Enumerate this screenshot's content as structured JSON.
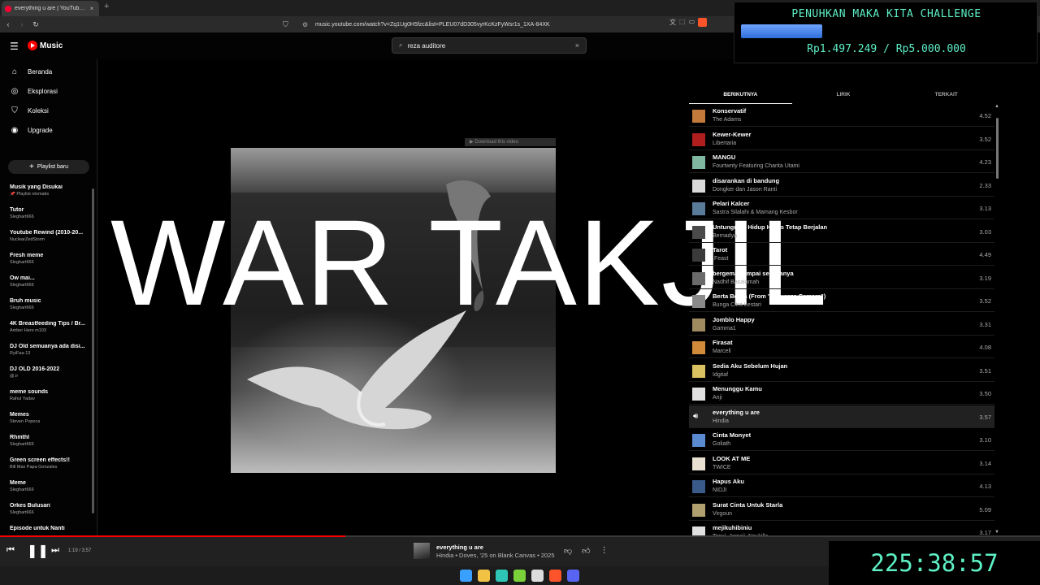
{
  "browser": {
    "tab_title": "everything u are | YouTube Music",
    "tab_close": "×",
    "new_tab": "+",
    "url": "music.youtube.com/watch?v=Zq1Ug0H5fzc&list=PLEU07dD305vyrKcKzFyWsr1s_1XA-84XK"
  },
  "header": {
    "logo": "Music",
    "search_value": "reza auditore",
    "search_clear": "×"
  },
  "sidebar": {
    "nav": [
      {
        "label": "Beranda",
        "icon": "home-icon"
      },
      {
        "label": "Eksplorasi",
        "icon": "compass-icon"
      },
      {
        "label": "Koleksi",
        "icon": "bookmark-icon"
      },
      {
        "label": "Upgrade",
        "icon": "youtube-icon"
      }
    ],
    "new_playlist": "Playlist baru",
    "playlists": [
      {
        "name": "Musik yang Disukai",
        "sub": "📌 Playlist otomatis"
      },
      {
        "name": "Tutor",
        "sub": "Sleghart666"
      },
      {
        "name": "Youtube Rewind (2010-20...",
        "sub": "NuclearZedStorm"
      },
      {
        "name": "Fresh meme",
        "sub": "Sleghart666"
      },
      {
        "name": "Ow mai...",
        "sub": "Sleghart666"
      },
      {
        "name": "Bruh music",
        "sub": "Sleghart666"
      },
      {
        "name": "4K Breastfeeding Tips / Br...",
        "sub": "Amber Hero m103"
      },
      {
        "name": "DJ Old semuanya ada disi...",
        "sub": "RyiFaa-13"
      },
      {
        "name": "DJ OLD 2016-2022",
        "sub": "@.ir"
      },
      {
        "name": "meme sounds",
        "sub": "Rahul Yadav"
      },
      {
        "name": "Memes",
        "sub": "Steven Popoca"
      },
      {
        "name": "Rhmthl",
        "sub": "Sleghart666"
      },
      {
        "name": "Green screen effects!!",
        "sub": "Bill Max Papa Gonzales"
      },
      {
        "name": "Meme",
        "sub": "Sleghart666"
      },
      {
        "name": "Orkes Bulusari",
        "sub": "Sleghart666"
      },
      {
        "name": "Episode untuk Nanti",
        "sub": ""
      }
    ]
  },
  "main": {
    "download_bar": "▶ Download this video",
    "overlay_text": "WAR TAKJIL"
  },
  "queue": {
    "tabs": [
      "BERIKUTNYA",
      "LIRIK",
      "TERKAIT"
    ],
    "items": [
      {
        "title": "Konservatif",
        "artist": "The Adams",
        "duration": "4.52",
        "color": "#c47a3b"
      },
      {
        "title": "Kewer-Kewer",
        "artist": "Libertaria",
        "duration": "3.52",
        "color": "#b01e1e"
      },
      {
        "title": "MANGU",
        "artist": "Fourtwnty Featuring Charita Utami",
        "duration": "4.23",
        "color": "#7fb7a0"
      },
      {
        "title": "disarankan di bandung",
        "artist": "Dongker dan Jason Ranti",
        "duration": "2.33",
        "color": "#d9d9d9"
      },
      {
        "title": "Pelari Kalcer",
        "artist": "Sastra Silalahi & Mamang Kesbor",
        "duration": "3.13",
        "color": "#5a7a9a"
      },
      {
        "title": "Untungnya, Hidup Harus Tetap Berjalan",
        "artist": "Bernadya",
        "duration": "3.03",
        "color": "#4a4a4a"
      },
      {
        "title": "Tarot",
        "artist": ".Feast",
        "duration": "4.49",
        "color": "#3a3a3a"
      },
      {
        "title": "bergema sampai selamanya",
        "artist": "Nadhif Basalamah",
        "duration": "3.19",
        "color": "#6a6a6a"
      },
      {
        "title": "Berta Berita (From \"Keluarga Cemara\")",
        "artist": "Bunga Citra Lestari",
        "duration": "3.52",
        "color": "#8a8a8a"
      },
      {
        "title": "Jomblo Happy",
        "artist": "Gamma1",
        "duration": "3.31",
        "color": "#a08a60"
      },
      {
        "title": "Firasat",
        "artist": "Marcell",
        "duration": "4.08",
        "color": "#d08a3a"
      },
      {
        "title": "Sedia Aku Sebelum Hujan",
        "artist": "Idgitaf",
        "duration": "3.51",
        "color": "#d9c060"
      },
      {
        "title": "Menunggu Kamu",
        "artist": "Anji",
        "duration": "3.50",
        "color": "#e0e0e0"
      },
      {
        "title": "everything u are",
        "artist": "Hindia",
        "duration": "3.57",
        "color": "#212121",
        "playing": true
      },
      {
        "title": "Cinta Monyet",
        "artist": "Goliath",
        "duration": "3.10",
        "color": "#5a8ad0"
      },
      {
        "title": "LOOK AT ME",
        "artist": "TWICE",
        "duration": "3.14",
        "color": "#e8e0d0"
      },
      {
        "title": "Hapus Aku",
        "artist": "NIDJI",
        "duration": "4.13",
        "color": "#3a5a8a"
      },
      {
        "title": "Surat Cinta Untuk Starla",
        "artist": "Virgoun",
        "duration": "5.09",
        "color": "#b0a070"
      },
      {
        "title": "mejikuhibiniu",
        "artist": "Tenxi, Jemsii, Naykilla",
        "duration": "3.17",
        "color": "#e0e0e0"
      }
    ]
  },
  "challenge": {
    "title": "PENUHKAN MAKA KITA CHALLENGE",
    "amount": "Rp1.497.249 / Rp5.000.000",
    "progress_fraction": 0.299
  },
  "player": {
    "time": "1:19 / 3:57",
    "progress_fraction": 0.332,
    "title": "everything u are",
    "subtitle": "Hindia • Doves, '25 on Blank Canvas • 2025"
  },
  "timer": "225:38:57",
  "taskbar": {
    "apps": [
      {
        "icon": "windows-start-icon",
        "color": "#3aa0ff"
      },
      {
        "icon": "file-explorer-icon",
        "color": "#f2c244"
      },
      {
        "icon": "edge-icon",
        "color": "#2ec4b6"
      },
      {
        "icon": "media-player-icon",
        "color": "#7ad13a"
      },
      {
        "icon": "chrome-icon",
        "color": "#dddddd"
      },
      {
        "icon": "brave-icon",
        "color": "#fb542b"
      },
      {
        "icon": "discord-icon",
        "color": "#5865f2"
      }
    ]
  }
}
